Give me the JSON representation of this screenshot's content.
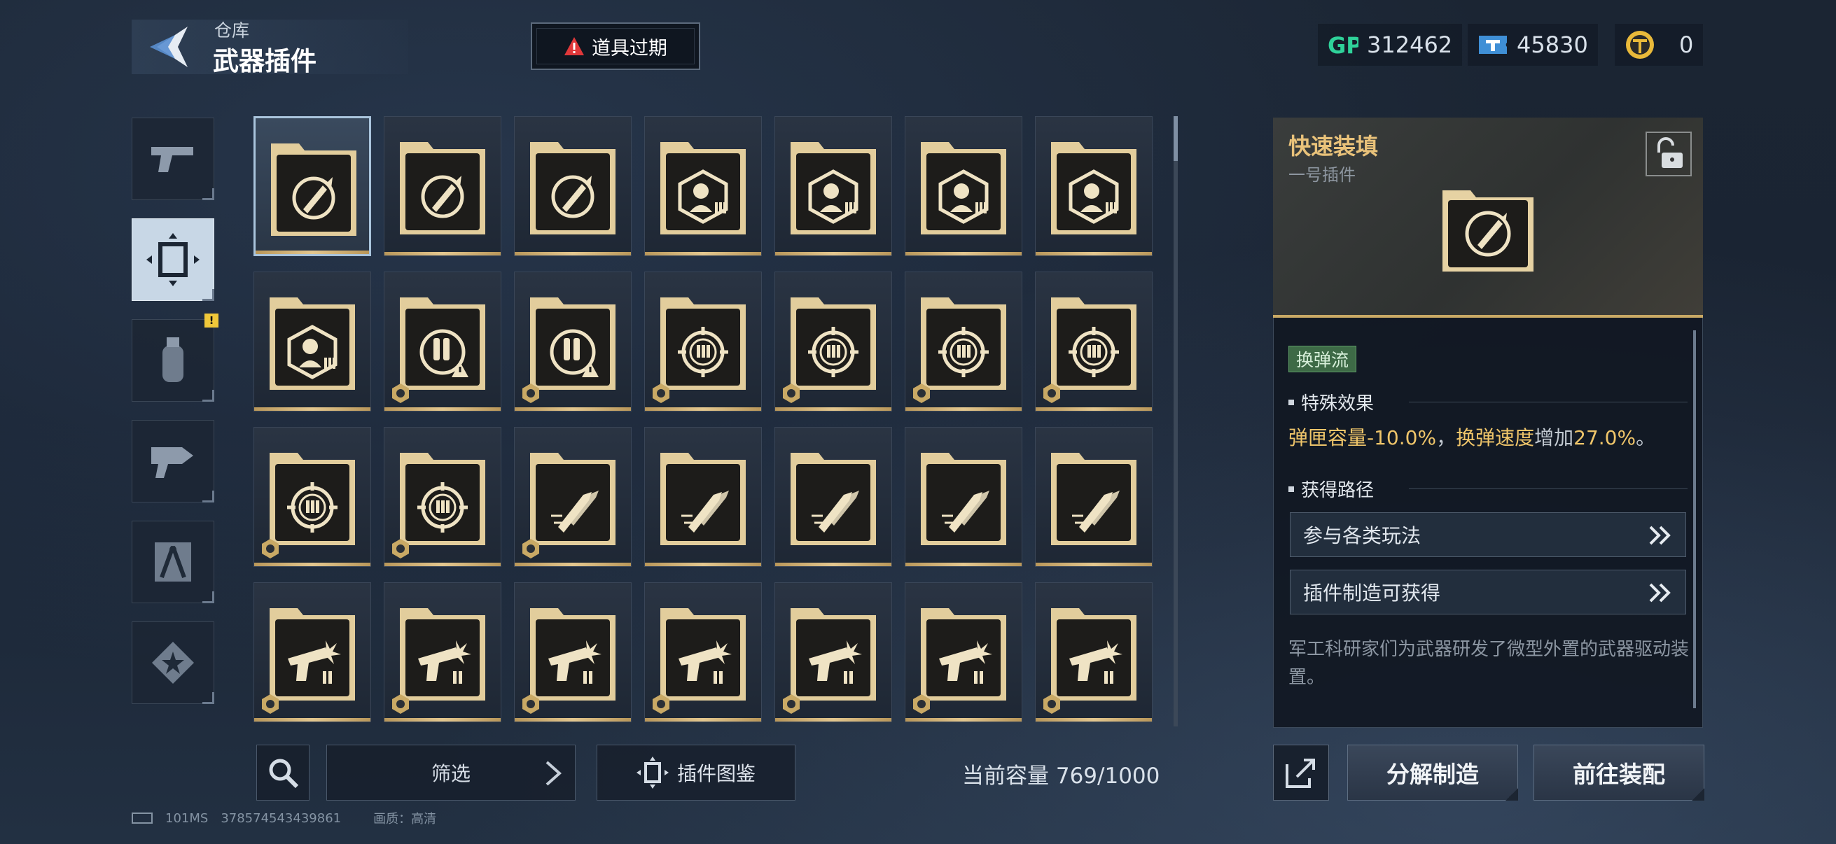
{
  "header": {
    "breadcrumb_parent": "仓库",
    "page_title": "武器插件",
    "alert_label": "道具过期"
  },
  "currencies": [
    {
      "icon": "gp-icon",
      "value": "312462"
    },
    {
      "icon": "ticket-icon",
      "value": "45830"
    },
    {
      "icon": "coin-icon",
      "value": "0"
    }
  ],
  "side_tabs": [
    {
      "name": "pistol-tab",
      "icon": "pistol-icon",
      "active": false
    },
    {
      "name": "plugin-tab",
      "icon": "plugin-frame-icon",
      "active": true
    },
    {
      "name": "grenade-tab",
      "icon": "grenade-icon",
      "active": false,
      "badge": "!"
    },
    {
      "name": "gun-part-tab",
      "icon": "gun-part-icon",
      "active": false
    },
    {
      "name": "compass-tab",
      "icon": "compass-icon",
      "active": false
    },
    {
      "name": "badge-tab",
      "icon": "star-badge-icon",
      "active": false
    }
  ],
  "grid_items": [
    {
      "icon": "rocket-reload",
      "mark": false,
      "selected": true
    },
    {
      "icon": "rocket-reload",
      "mark": false
    },
    {
      "icon": "rocket-reload",
      "mark": false
    },
    {
      "icon": "soldier-ammo",
      "mark": false
    },
    {
      "icon": "soldier-ammo",
      "mark": false
    },
    {
      "icon": "soldier-ammo",
      "mark": false
    },
    {
      "icon": "soldier-ammo",
      "mark": false
    },
    {
      "icon": "soldier-ammo",
      "mark": false
    },
    {
      "icon": "bullets-warning",
      "mark": true
    },
    {
      "icon": "bullets-warning",
      "mark": true
    },
    {
      "icon": "crosshair-bullets",
      "mark": true
    },
    {
      "icon": "crosshair-bullets",
      "mark": true
    },
    {
      "icon": "crosshair-bullets",
      "mark": true
    },
    {
      "icon": "crosshair-bullets",
      "mark": true
    },
    {
      "icon": "crosshair-bullets",
      "mark": true
    },
    {
      "icon": "crosshair-bullets",
      "mark": true
    },
    {
      "icon": "speed-bullets",
      "mark": true
    },
    {
      "icon": "speed-bullets",
      "mark": false
    },
    {
      "icon": "speed-bullets",
      "mark": false
    },
    {
      "icon": "speed-bullets",
      "mark": false
    },
    {
      "icon": "speed-bullets",
      "mark": false
    },
    {
      "icon": "gun-burst",
      "mark": true
    },
    {
      "icon": "gun-burst",
      "mark": true
    },
    {
      "icon": "gun-burst",
      "mark": true
    },
    {
      "icon": "gun-burst",
      "mark": true
    },
    {
      "icon": "gun-burst",
      "mark": true
    },
    {
      "icon": "gun-burst",
      "mark": true
    },
    {
      "icon": "gun-burst",
      "mark": true
    }
  ],
  "toolbar": {
    "filter_label": "筛选",
    "codex_label": "插件图鉴",
    "capacity_text": "当前容量 769/1000"
  },
  "status_bar": {
    "ping": "101MS",
    "id": "378574543439861",
    "quality": "画质：高清"
  },
  "detail": {
    "title": "快速装填",
    "subtitle": "一号插件",
    "tag": "换弹流",
    "effect_heading": "特殊效果",
    "effect": {
      "a_label": "弹匣容量",
      "a_value": "-10.0%",
      "sep": "，",
      "b_label": "换弹速度",
      "b_mid": "增加",
      "b_value": "27.0%",
      "end": "。"
    },
    "source_heading": "获得路径",
    "sources": [
      "参与各类玩法",
      "插件制造可获得"
    ],
    "description": "军工科研家们为武器研发了微型外置的武器驱动装置。"
  },
  "actions": {
    "disassemble_label": "分解制造",
    "equip_label": "前往装配"
  },
  "colors": {
    "gold": "#efc56a",
    "gold_bar": "#c9a965",
    "tag_green": "#3d6a46",
    "alert_red": "#e0383a",
    "gp_green": "#2fd29a"
  }
}
